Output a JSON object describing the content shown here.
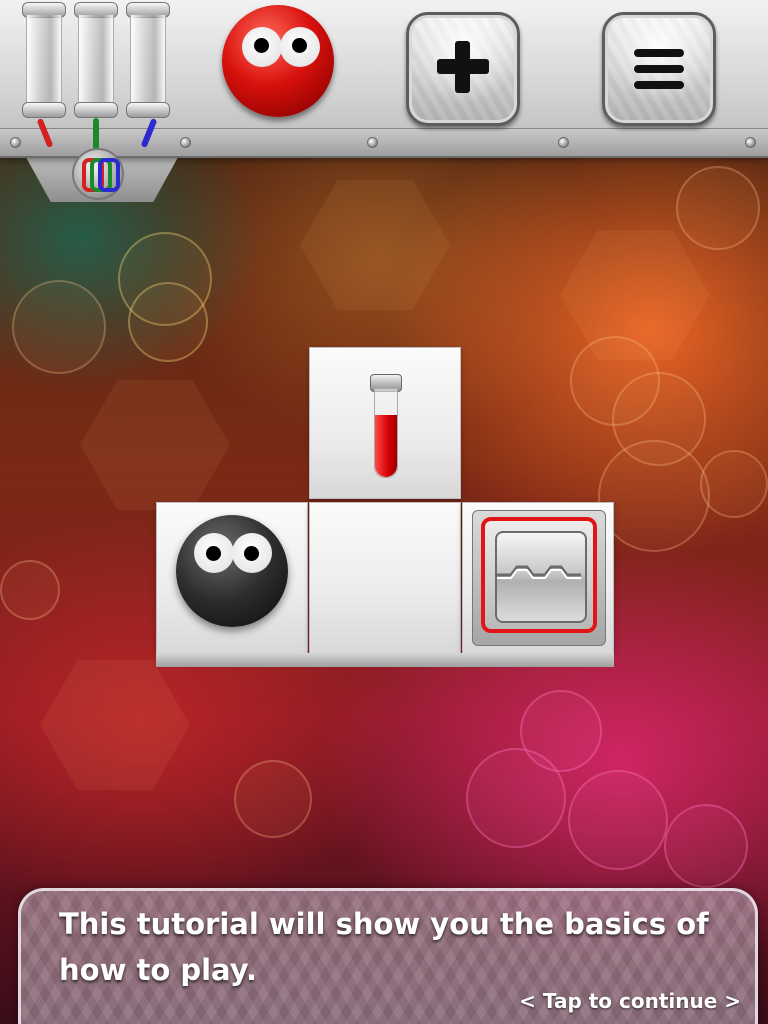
{
  "top_bar": {
    "add_button_icon": "plus-icon",
    "menu_button_icon": "menu-icon",
    "tubes": [
      {
        "wire_color": "#d32020"
      },
      {
        "wire_color": "#1a8a2a"
      },
      {
        "wire_color": "#2a2ad0"
      }
    ]
  },
  "player_indicator": {
    "color": "#d8110d"
  },
  "board": {
    "tiles": [
      {
        "contains": "test-tube",
        "fluid_color": "#d40000"
      },
      {
        "contains": "black-blob",
        "color": "#2d2d2d"
      },
      {
        "contains": "empty"
      },
      {
        "contains": "exit-gate",
        "highlight_color": "#e11515"
      }
    ]
  },
  "dialog": {
    "message": "This tutorial will show you the basics of how to play.",
    "continue_label": "< Tap to continue >"
  }
}
